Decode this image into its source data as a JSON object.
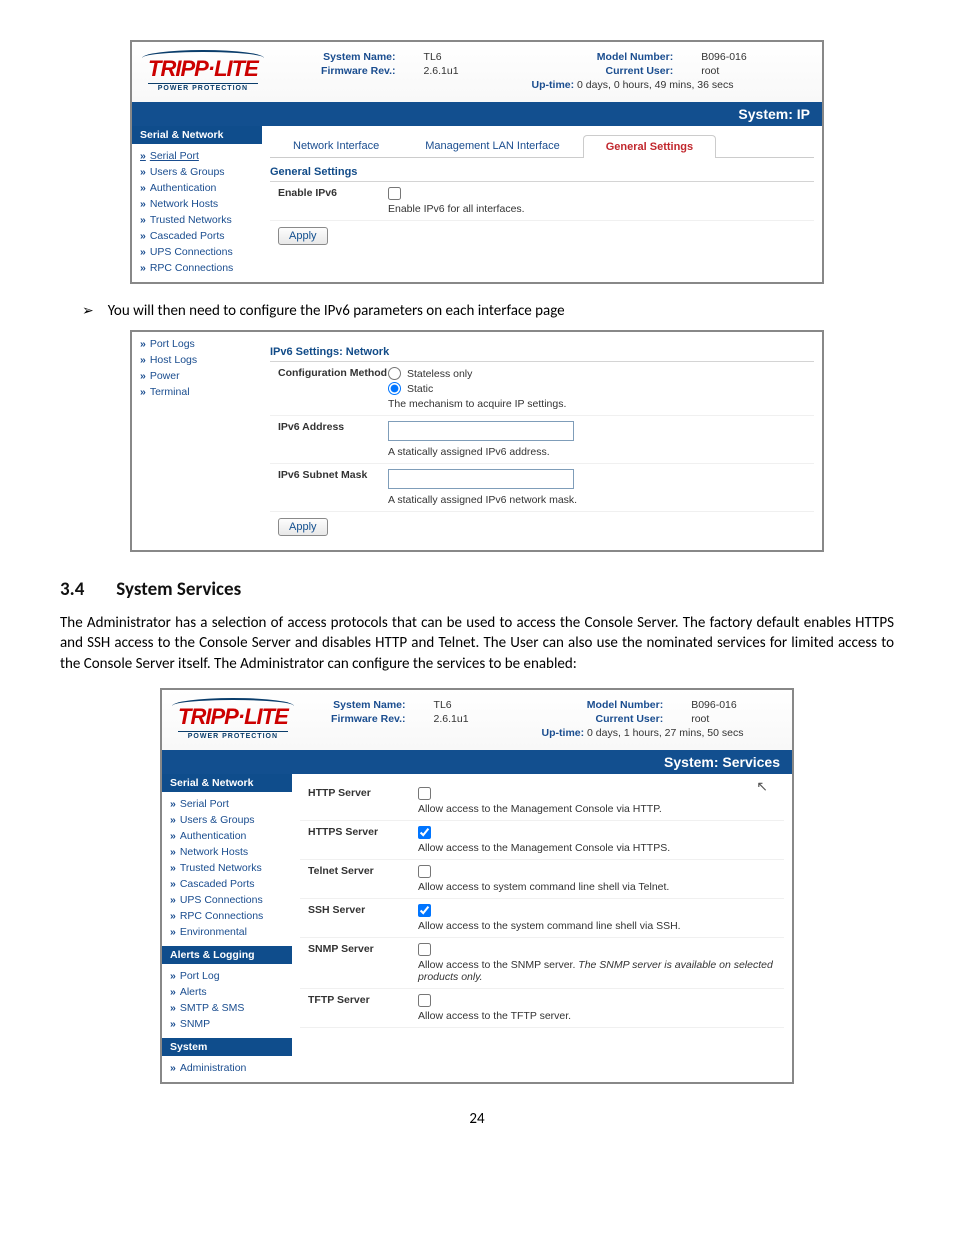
{
  "page_number": "24",
  "bullet": {
    "arrow": "➢",
    "text": "You will then need to configure the IPv6 parameters on each interface page"
  },
  "section_heading": {
    "num": "3.4",
    "title": "System Services"
  },
  "section_intro": "The Administrator has a selection of access protocols that can be used to access the Console Server. The factory default enables HTTPS and SSH access to the Console Server and disables HTTP and Telnet. The User can also use the nominated services for limited access to the Console Server itself. The Administrator can configure the services to be enabled:",
  "shot1": {
    "logo_sub": "POWER PROTECTION",
    "info": {
      "l1": "System Name:",
      "v1": "TL6",
      "l2": "Firmware Rev.:",
      "v2": "2.6.1u1",
      "l3": "Model Number:",
      "v3": "B096-016",
      "l4": "Current User:",
      "v4": "root",
      "uptime_lbl": "Up-time:",
      "uptime_val": "0 days, 0 hours, 49 mins, 36 secs"
    },
    "banner": "System: IP",
    "sidebar_cat": "Serial & Network",
    "sidebar": [
      "Serial Port",
      "Users & Groups",
      "Authentication",
      "Network Hosts",
      "Trusted Networks",
      "Cascaded Ports",
      "UPS Connections",
      "RPC Connections"
    ],
    "tabs": {
      "t1": "Network Interface",
      "t2": "Management LAN Interface",
      "t3": "General Settings"
    },
    "sect_title": "General Settings",
    "row": {
      "label": "Enable IPv6",
      "desc": "Enable IPv6 for all interfaces."
    },
    "apply": "Apply"
  },
  "shot2": {
    "sidebar": [
      "Port Logs",
      "Host Logs",
      "Power",
      "Terminal"
    ],
    "sect_title": "IPv6 Settings: Network",
    "rows": {
      "cfg": {
        "label": "Configuration Method",
        "opt1": "Stateless only",
        "opt2": "Static",
        "desc": "The mechanism to acquire IP settings."
      },
      "addr": {
        "label": "IPv6 Address",
        "desc": "A statically assigned IPv6 address."
      },
      "mask": {
        "label": "IPv6 Subnet Mask",
        "desc": "A statically assigned IPv6 network mask."
      }
    },
    "apply": "Apply"
  },
  "shot3": {
    "logo_sub": "POWER PROTECTION",
    "info": {
      "l1": "System Name:",
      "v1": "TL6",
      "l2": "Firmware Rev.:",
      "v2": "2.6.1u1",
      "l3": "Model Number:",
      "v3": "B096-016",
      "l4": "Current User:",
      "v4": "root",
      "uptime_lbl": "Up-time:",
      "uptime_val": "0 days, 1 hours, 27 mins, 50 secs"
    },
    "banner": "System: Services",
    "sidebar": {
      "cat1": "Serial & Network",
      "g1": [
        "Serial Port",
        "Users & Groups",
        "Authentication",
        "Network Hosts",
        "Trusted Networks",
        "Cascaded Ports",
        "UPS Connections",
        "RPC Connections",
        "Environmental"
      ],
      "cat2": "Alerts & Logging",
      "g2": [
        "Port Log",
        "Alerts",
        "SMTP & SMS",
        "SNMP"
      ],
      "cat3": "System",
      "g3": [
        "Administration"
      ]
    },
    "rows": {
      "http": {
        "label": "HTTP Server",
        "checked": false,
        "desc": "Allow access to the Management Console via HTTP."
      },
      "https": {
        "label": "HTTPS Server",
        "checked": true,
        "desc": "Allow access to the Management Console via HTTPS."
      },
      "telnet": {
        "label": "Telnet Server",
        "checked": false,
        "desc": "Allow access to system command line shell via Telnet."
      },
      "ssh": {
        "label": "SSH Server",
        "checked": true,
        "desc": "Allow access to the system command line shell via SSH."
      },
      "snmp": {
        "label": "SNMP Server",
        "checked": false,
        "desc": "Allow access to the SNMP server. ",
        "desc_em": "The SNMP server is available on selected products only."
      },
      "tftp": {
        "label": "TFTP Server",
        "checked": false,
        "desc": "Allow access to the TFTP server."
      }
    }
  }
}
